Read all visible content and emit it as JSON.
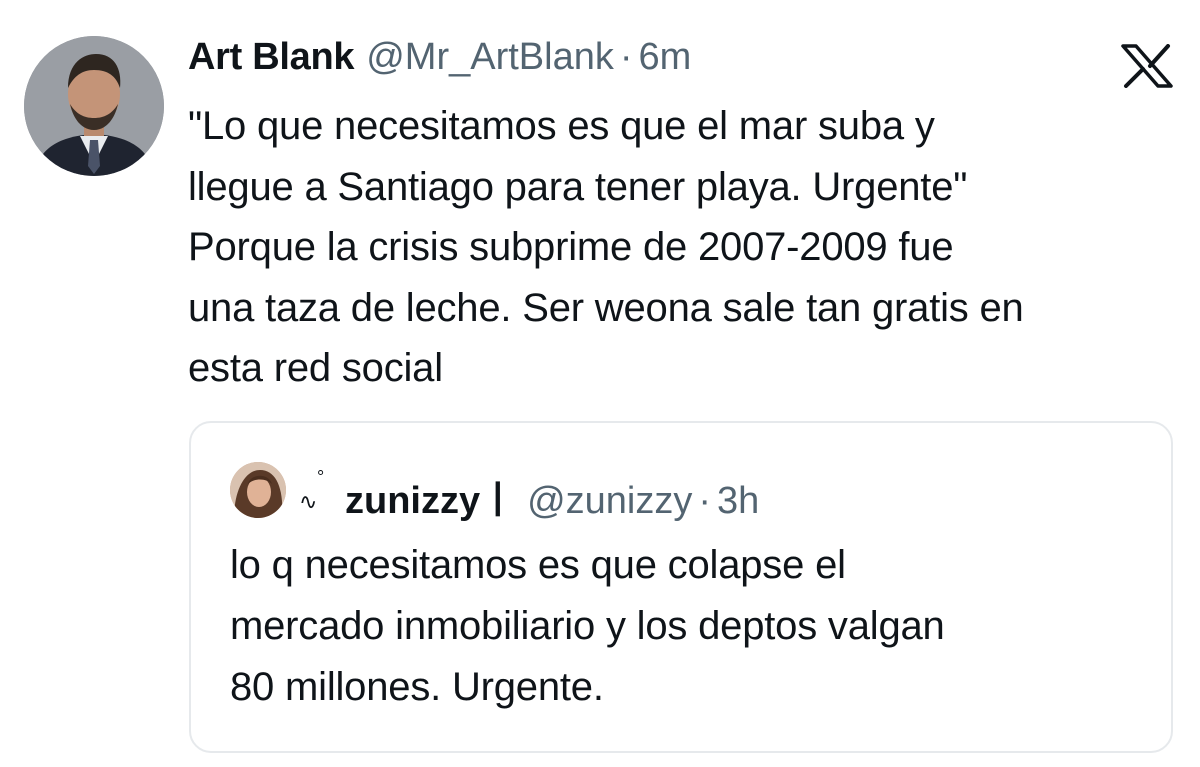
{
  "tweet": {
    "author": {
      "display_name": "Art Blank",
      "handle": "@Mr_ArtBlank",
      "separator": "·",
      "time": "6m"
    },
    "platform_icon": "x-logo-icon",
    "text_lines": [
      "\"Lo que necesitamos es que el mar suba y",
      "llegue a Santiago para tener playa. Urgente\"",
      "Porque la crisis subprime de 2007-2009 fue",
      "una taza de leche. Ser weona sale tan gratis en",
      "esta red social"
    ]
  },
  "quoted_tweet": {
    "author": {
      "decoration": "∿",
      "decoration_ring": "°",
      "display_name": "zunizzyㅣ",
      "handle": "@zunizzy",
      "separator": "·",
      "time": "3h"
    },
    "text_lines": [
      "lo q necesitamos es que colapse el",
      "mercado inmobiliario y los deptos valgan",
      "80 millones. Urgente."
    ]
  },
  "colors": {
    "primary_text": "#0f1419",
    "secondary_text": "#536471",
    "quote_border": "#e6e9ec",
    "background": "#ffffff"
  }
}
